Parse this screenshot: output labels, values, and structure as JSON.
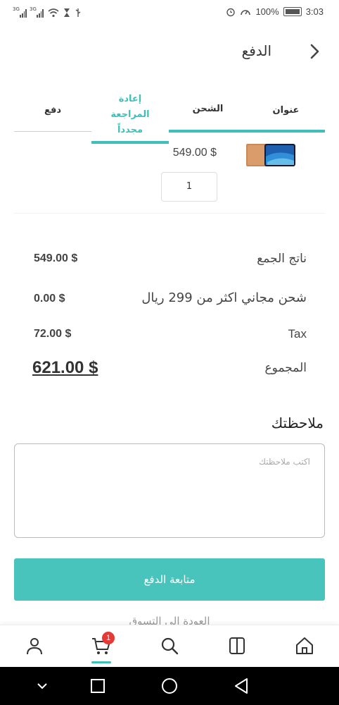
{
  "status_bar": {
    "sim1_tag": "3G",
    "sim2_tag": "3G",
    "battery": "100%",
    "time": "3:03",
    "icons": [
      "signal-icon",
      "signal-icon",
      "wifi-icon",
      "hourglass-icon",
      "usb-icon",
      "alarm-icon",
      "speedometer-icon",
      "battery-icon"
    ]
  },
  "header": {
    "title": "الدفع",
    "back_icon": "chevron-right-icon"
  },
  "steps": [
    {
      "label": "عنوان",
      "state": "done"
    },
    {
      "label": "الشحن",
      "state": "done"
    },
    {
      "label": "إعادة المراجعة مجدداً",
      "state": "active"
    },
    {
      "label": "دفع",
      "state": "pending"
    }
  ],
  "product": {
    "price": "549.00 $",
    "quantity": "1",
    "image_icon": "phone-product-image"
  },
  "summary": {
    "subtotal_label": "ناتج الجمع",
    "subtotal_value": "549.00 $",
    "shipping_label": "شحن مجاني اكثر من 299 ريال",
    "shipping_value": "0.00 $",
    "tax_label": "Tax",
    "tax_value": "72.00 $",
    "total_label": "المجموع",
    "total_value": "621.00 $"
  },
  "notes": {
    "title": "ملاحظتك",
    "placeholder": "اكتب ملاحظتك"
  },
  "actions": {
    "continue_label": "متابعة الدفع",
    "back_to_shop_label": "العودة إلى التسوق"
  },
  "bottom_nav": {
    "items": [
      "profile-icon",
      "cart-icon",
      "search-icon",
      "catalog-icon",
      "home-icon"
    ],
    "cart_count": "1"
  },
  "android_nav": {
    "items": [
      "chevron-down-icon",
      "recents-icon",
      "home-circle-icon",
      "back-triangle-icon"
    ]
  },
  "colors": {
    "accent": "#3fbfb7",
    "button": "#49c4bc",
    "badge": "#e53935"
  }
}
